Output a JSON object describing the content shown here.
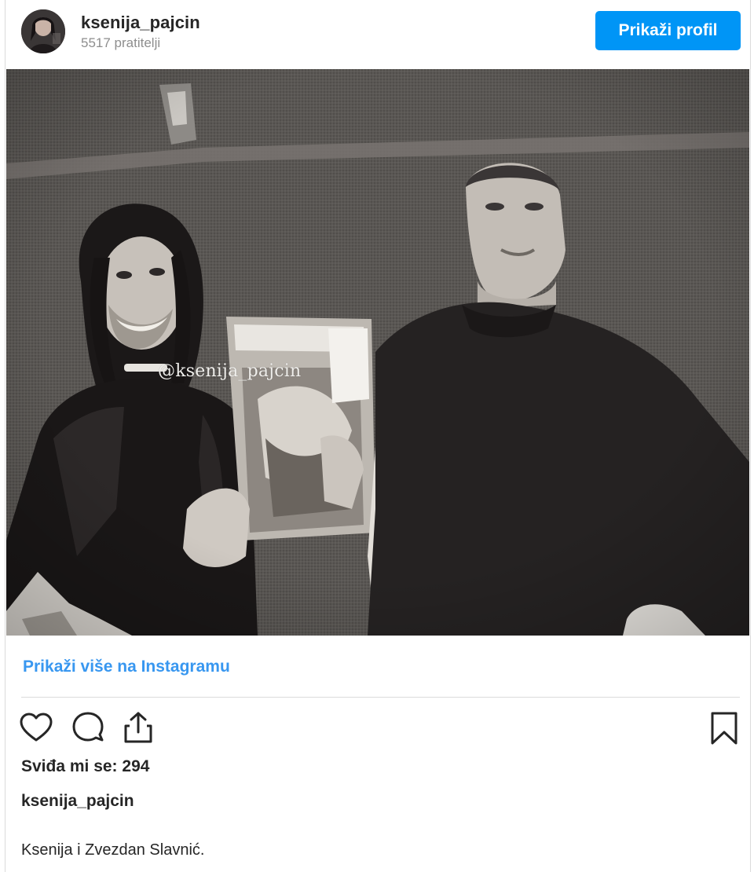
{
  "header": {
    "username": "ksenija_pajcin",
    "followers": "5517 pratitelji",
    "view_profile_label": "Prikaži profil",
    "button_color": "#0095f6"
  },
  "post": {
    "photo_watermark": "@ksenija_pajcin",
    "view_more_label": "Prikaži više na Instagramu",
    "likes": "Sviđa mi se: 294",
    "owner": "ksenija_pajcin",
    "caption": "Ksenija i Zvezdan Slavnić."
  },
  "actions": {
    "icons": [
      "heart-icon",
      "comment-icon",
      "share-icon",
      "bookmark-icon"
    ]
  },
  "colors": {
    "link": "#3897f0",
    "text": "#262626",
    "muted": "#8e8e8e",
    "divider": "#dbdbdb"
  }
}
